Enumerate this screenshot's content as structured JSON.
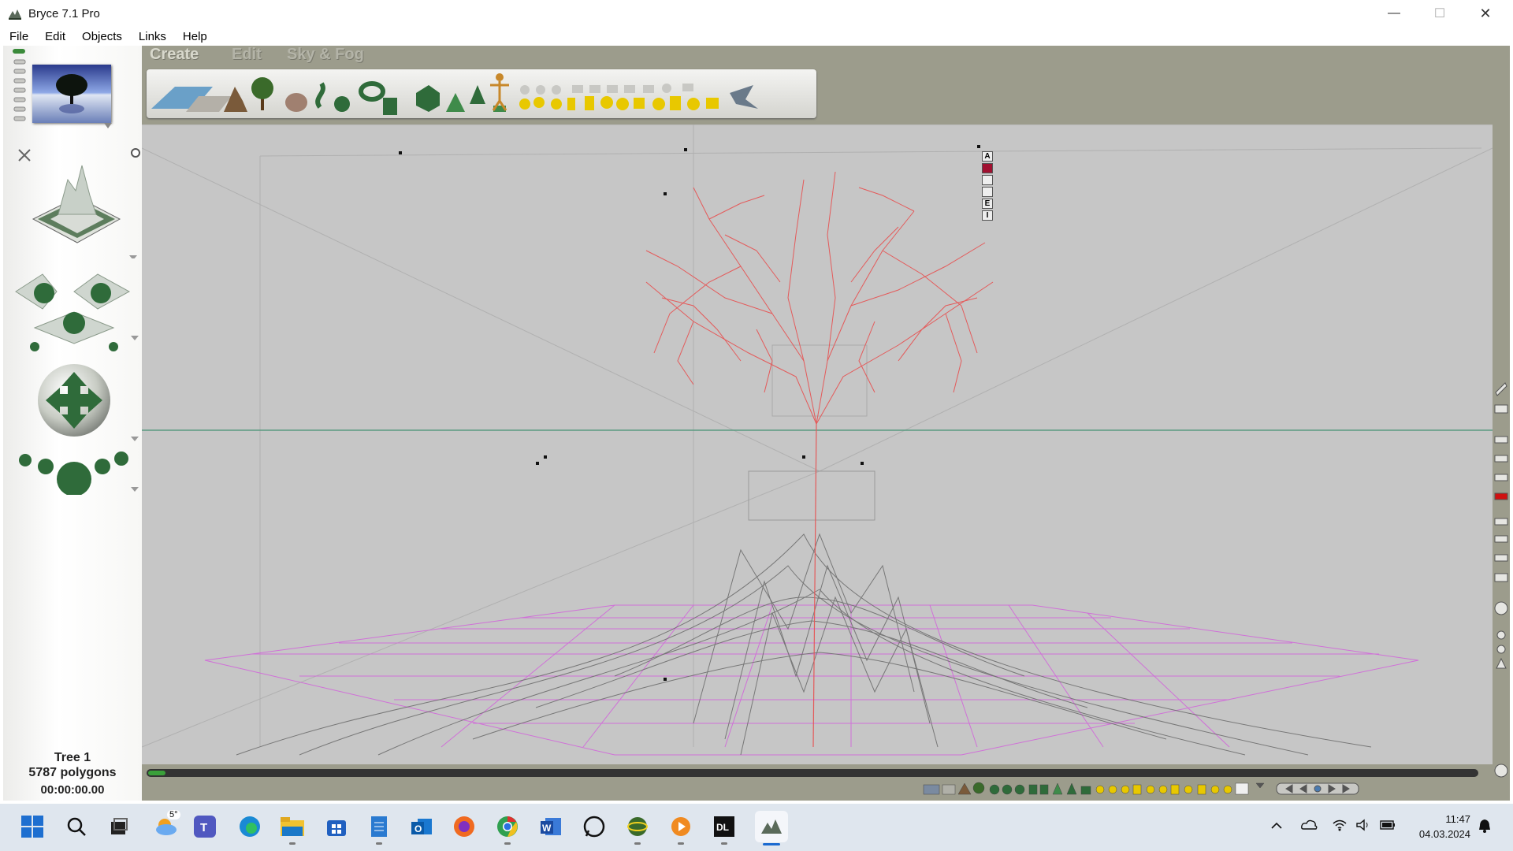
{
  "window": {
    "title": "Bryce 7.1  Pro",
    "minimize_glyph": "—",
    "maximize_glyph": "☐",
    "close_glyph": "✕"
  },
  "menu": [
    "File",
    "Edit",
    "Objects",
    "Links",
    "Help"
  ],
  "palette_tabs": [
    "Create",
    "Edit",
    "Sky & Fog"
  ],
  "view_controls": [
    "A",
    "",
    "",
    "",
    "E",
    "I"
  ],
  "status": {
    "object_name": "Tree 1",
    "polygons": "5787 polygons",
    "timecode": "00:00:00.00"
  },
  "taskbar": {
    "weather_temp": "5°",
    "time": "11:47",
    "date": "04.03.2024"
  },
  "colors": {
    "viewport_bg": "#c6c6c6",
    "panel_bg": "#9c9c8c",
    "tree_wire": "#e45a5a",
    "terrain_wire": "#6a6a6a",
    "ground_grid": "#d070d8",
    "horizon": "#5a9a80"
  }
}
